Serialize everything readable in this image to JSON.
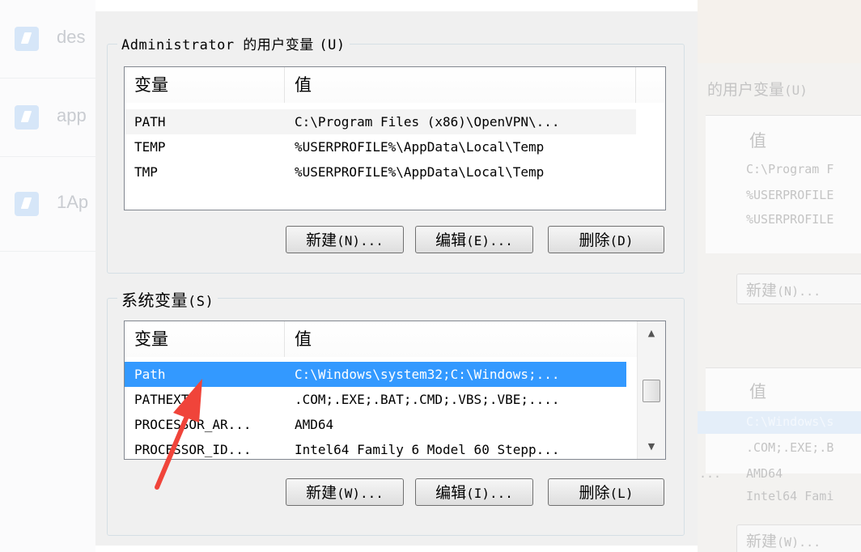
{
  "background_apps": [
    {
      "label": "des"
    },
    {
      "label": "app"
    },
    {
      "label": "1Ap"
    }
  ],
  "user_vars": {
    "title": "Administrator 的用户变量",
    "hotkey": "(U)",
    "col_var": "变量",
    "col_val": "值",
    "rows": [
      {
        "var": "PATH",
        "val": "C:\\Program Files (x86)\\OpenVPN\\..."
      },
      {
        "var": "TEMP",
        "val": "%USERPROFILE%\\AppData\\Local\\Temp"
      },
      {
        "var": "TMP",
        "val": "%USERPROFILE%\\AppData\\Local\\Temp"
      }
    ],
    "btn_new": "新建",
    "btn_new_key": "(N)...",
    "btn_edit": "编辑",
    "btn_edit_key": "(E)...",
    "btn_delete": "删除",
    "btn_delete_key": "(D)"
  },
  "system_vars": {
    "title": "系统变量",
    "hotkey": "(S)",
    "col_var": "变量",
    "col_val": "值",
    "rows": [
      {
        "var": "Path",
        "val": "C:\\Windows\\system32;C:\\Windows;..."
      },
      {
        "var": "PATHEXT",
        "val": ".COM;.EXE;.BAT;.CMD;.VBS;.VBE;...."
      },
      {
        "var": "PROCESSOR_AR...",
        "val": "AMD64"
      },
      {
        "var": "PROCESSOR_ID...",
        "val": "Intel64 Family 6 Model 60 Stepp..."
      }
    ],
    "selected_index": 0,
    "btn_new": "新建",
    "btn_new_key": "(W)...",
    "btn_edit": "编辑",
    "btn_edit_key": "(I)...",
    "btn_delete": "删除",
    "btn_delete_key": "(L)"
  },
  "bg_dialog": {
    "user_title": "的用户变量",
    "user_key": "(U)",
    "col_val": "值",
    "user_vals": [
      "C:\\Program F",
      "%USERPROFILE",
      "%USERPROFILE"
    ],
    "btn_new": "新建",
    "btn_new_key": "(N)...",
    "sys_vals": [
      "C:\\Windows\\s",
      ".COM;.EXE;.B",
      "AMD64",
      "Intel64 Fami"
    ],
    "ellipsis": "...",
    "btn_new2": "新建",
    "btn_new2_key": "(W)..."
  },
  "colors": {
    "selection": "#3399ff",
    "annotation_arrow": "#f0443a",
    "dialog_bg": "#f0f0f0"
  }
}
